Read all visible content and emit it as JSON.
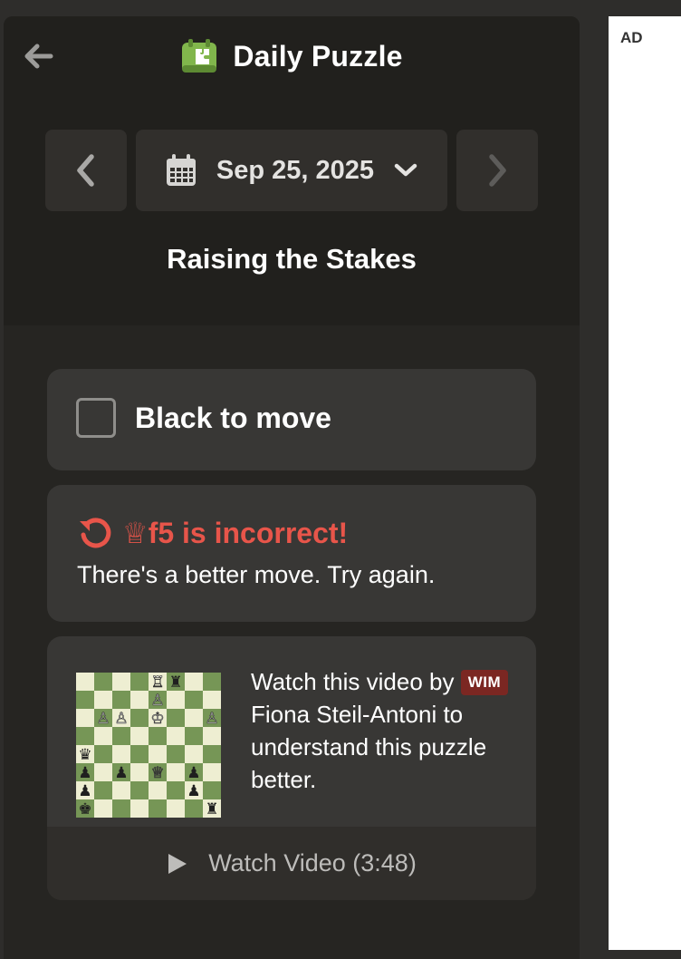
{
  "header": {
    "title": "Daily Puzzle",
    "icons": {
      "back": "back-arrow-icon",
      "logo": "daily-puzzle-icon",
      "logo_color": "#81b64c"
    }
  },
  "date_nav": {
    "date": "Sep 25, 2025",
    "icons": {
      "prev": "chevron-left-icon",
      "calendar": "calendar-icon",
      "dropdown": "chevron-down-icon",
      "next": "chevron-right-icon"
    }
  },
  "puzzle": {
    "name": "Raising the Stakes",
    "to_move": "Black to move"
  },
  "feedback": {
    "move": "f5 is incorrect!",
    "piece_glyph": "♕",
    "message": "There's a better move. Try again.",
    "color": "#e8554a",
    "icon": "retry-icon"
  },
  "video": {
    "text_before": "Watch this video by",
    "title_badge": "WIM",
    "text_after": "Fiona Steil-Antoni to understand this puzzle better.",
    "button_label": "Watch Video (3:48)",
    "icon": "play-icon",
    "board": [
      [
        "",
        "",
        "",
        "",
        "♖",
        "♜",
        "",
        ""
      ],
      [
        "",
        "",
        "",
        "",
        "♙",
        "",
        "",
        ""
      ],
      [
        "",
        "♙",
        "♙",
        "",
        "♔",
        "",
        "",
        "♙"
      ],
      [
        "",
        "",
        "",
        "",
        "",
        "",
        "",
        ""
      ],
      [
        "♛",
        "",
        "",
        "",
        "",
        "",
        "",
        ""
      ],
      [
        "♟",
        "",
        "♟",
        "",
        "♕",
        "",
        "♟",
        ""
      ],
      [
        "♟",
        "",
        "",
        "",
        "",
        "",
        "♟",
        ""
      ],
      [
        "♚",
        "",
        "",
        "",
        "",
        "",
        "",
        "♜"
      ]
    ]
  },
  "ad": {
    "label": "AD"
  },
  "colors": {
    "page_bg": "#2e2d2b",
    "panel_bg": "#262522",
    "card_bg": "#383735",
    "board_light": "#eeeed2",
    "board_dark": "#769656",
    "badge_bg": "#7b2722"
  }
}
